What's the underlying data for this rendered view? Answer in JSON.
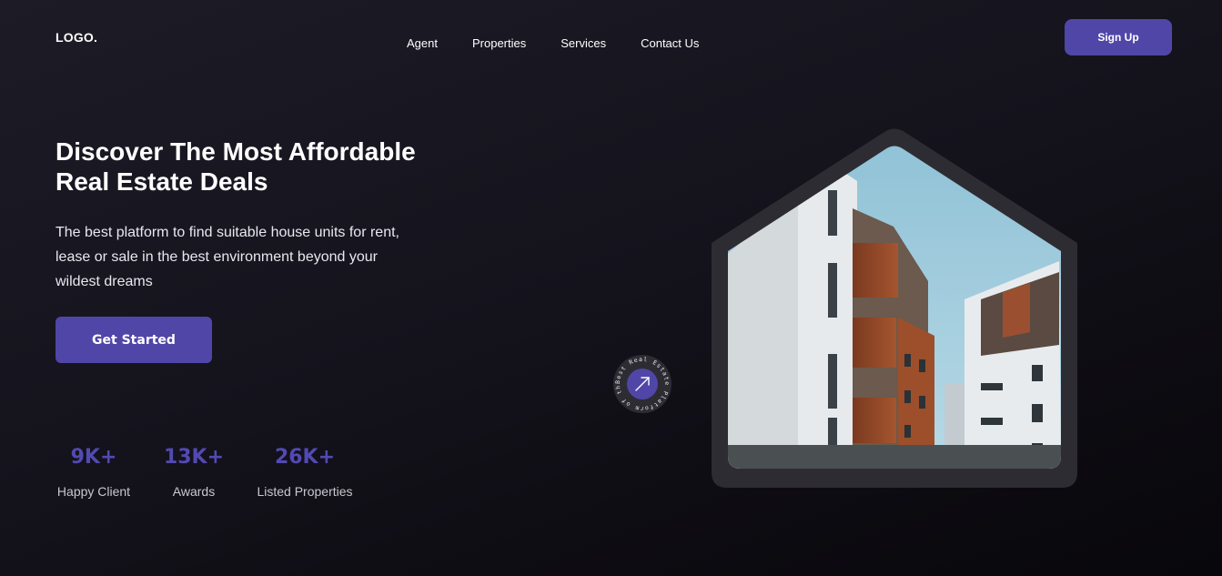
{
  "header": {
    "logo": "LOGO.",
    "nav": [
      "Agent",
      "Properties",
      "Services",
      "Contact Us"
    ],
    "signup_label": "Sign Up"
  },
  "hero": {
    "title_line1": "Discover The Most Affordable",
    "title_line2": "Real Estate Deals",
    "description": "The best platform to find suitable house units for rent, lease or sale in the best environment beyond your wildest dreams",
    "cta_label": "Get Started"
  },
  "stats": [
    {
      "value": "9K+",
      "label": "Happy Client"
    },
    {
      "value": "13K+",
      "label": "Awards"
    },
    {
      "value": "26K+",
      "label": "Listed Properties"
    }
  ],
  "badge": {
    "ring_text": "Best Real Estate Platform of the Year",
    "icon": "arrow-up-right-icon"
  },
  "image": {
    "subject": "modern apartment buildings with brown balconies under blue sky"
  },
  "colors": {
    "accent": "#5046a8",
    "accent_text": "#5249b3",
    "background": "#15131c",
    "frame": "#2e2c33"
  }
}
